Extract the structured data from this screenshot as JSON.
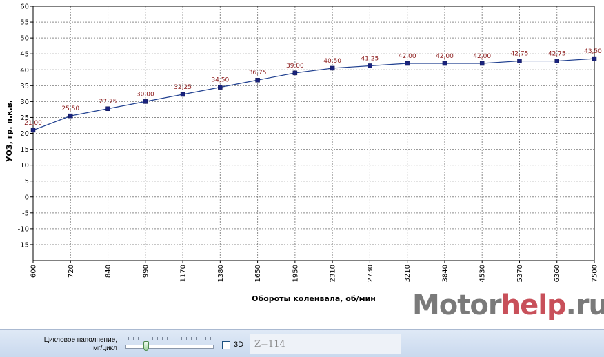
{
  "chart_data": {
    "type": "line",
    "title": "",
    "xlabel": "Обороты коленвала, об/мин",
    "ylabel": "УОЗ, гр. п.к.в.",
    "categories": [
      "600",
      "720",
      "840",
      "990",
      "1170",
      "1380",
      "1650",
      "1950",
      "2310",
      "2730",
      "3210",
      "3840",
      "4530",
      "5370",
      "6360",
      "7500"
    ],
    "series": [
      {
        "values": [
          21.0,
          25.5,
          27.75,
          30.0,
          32.25,
          34.5,
          36.75,
          39.0,
          40.5,
          41.25,
          42.0,
          42.0,
          42.0,
          42.75,
          42.75,
          43.5
        ],
        "labels": [
          "21,00",
          "25,50",
          "27,75",
          "30,00",
          "32,25",
          "34,50",
          "36,75",
          "39,00",
          "40,50",
          "41,25",
          "42,00",
          "42,00",
          "42,00",
          "42,75",
          "42,75",
          "43,50"
        ]
      }
    ],
    "ylim": [
      -20,
      60
    ],
    "yticks": [
      -15,
      -10,
      -5,
      0,
      5,
      10,
      15,
      20,
      25,
      30,
      35,
      40,
      45,
      50,
      55,
      60
    ],
    "grid": true,
    "legend": "none",
    "line_color": "#1f3f8f",
    "marker_color": "#1a237e",
    "label_color": "#8b1a1a"
  },
  "watermark": {
    "part1": "Motor",
    "part2": "help",
    "part3": ".ru"
  },
  "controls": {
    "fill_label_line1": "Цикловое наполнение,",
    "fill_label_line2": "мг/цикл",
    "slider_value": 0.2,
    "checkbox_3d_label": "3D",
    "checkbox_3d_checked": false,
    "z_text": "Z=114"
  }
}
